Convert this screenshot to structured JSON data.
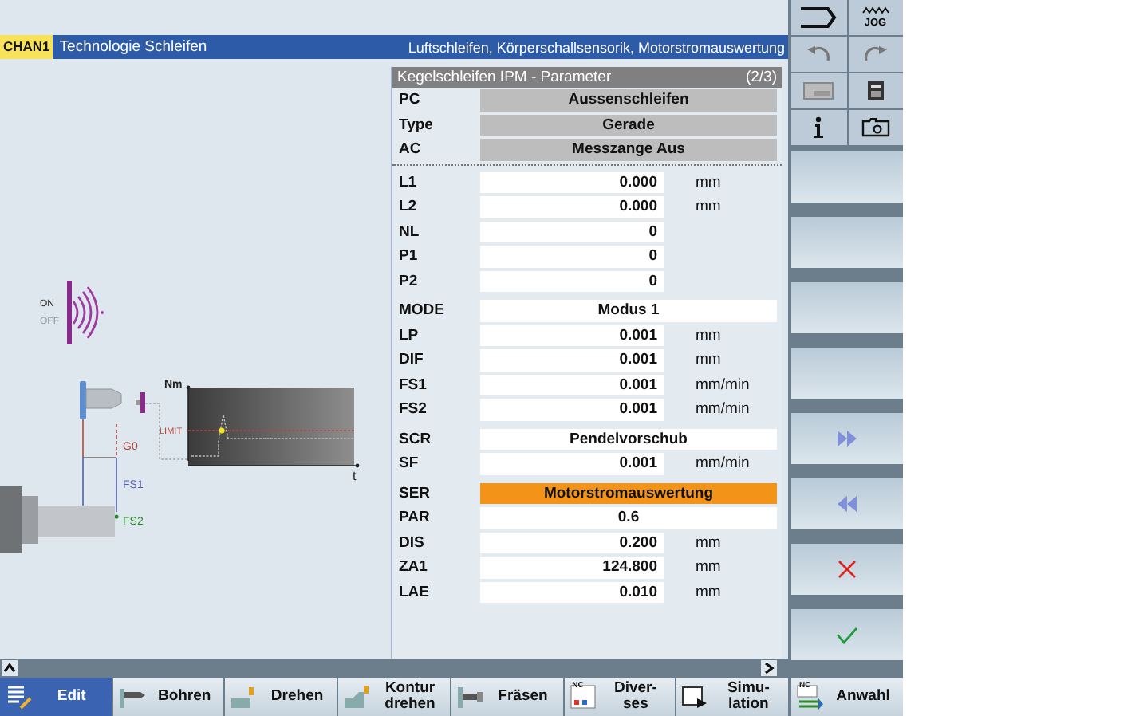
{
  "header": {
    "channel": "CHAN1",
    "title": "Technologie Schleifen",
    "subtitle": "Luftschleifen, Körperschallsensorik, Motorstromauswertung"
  },
  "diagram": {
    "switch": [
      {
        "label": "ON",
        "selected": true
      },
      {
        "label": "OFF",
        "selected": false
      }
    ],
    "y_axis": "Nm",
    "x_axis": "t",
    "limit": "LIMIT",
    "moves": [
      "G0",
      "FS1",
      "FS2"
    ]
  },
  "form": {
    "title": "Kegelschleifen IPM - Parameter",
    "page": "(2/3)",
    "groups": [
      [
        {
          "label": "PC",
          "kind": "toggle",
          "value": "Aussenschleifen",
          "selected": false
        },
        {
          "label": "Type",
          "kind": "toggle",
          "value": "Gerade",
          "selected": false
        },
        {
          "label": "AC",
          "kind": "toggle",
          "value": "Messzange Aus",
          "selected": false
        }
      ],
      [
        {
          "label": "L1",
          "kind": "number",
          "value": "0.000",
          "unit": "mm",
          "selected": false
        },
        {
          "label": "L2",
          "kind": "number",
          "value": "0.000",
          "unit": "mm",
          "selected": false
        },
        {
          "label": "NL",
          "kind": "number",
          "value": "0",
          "selected": false
        },
        {
          "label": "P1",
          "kind": "number",
          "value": "0",
          "selected": false
        },
        {
          "label": "P2",
          "kind": "number",
          "value": "0",
          "selected": false
        }
      ],
      [
        {
          "label": "MODE",
          "kind": "choice",
          "value": "Modus 1",
          "selected": false
        },
        {
          "label": "LP",
          "kind": "number",
          "value": "0.001",
          "unit": "mm",
          "selected": false
        },
        {
          "label": "DIF",
          "kind": "number",
          "value": "0.001",
          "unit": "mm",
          "selected": false
        },
        {
          "label": "FS1",
          "kind": "number",
          "value": "0.001",
          "unit": "mm/min",
          "selected": false
        },
        {
          "label": "FS2",
          "kind": "number",
          "value": "0.001",
          "unit": "mm/min",
          "selected": false
        }
      ],
      [
        {
          "label": "SCR",
          "kind": "choice",
          "value": "Pendelvorschub",
          "selected": false
        },
        {
          "label": "SF",
          "kind": "number",
          "value": "0.001",
          "unit": "mm/min",
          "selected": false
        }
      ],
      [
        {
          "label": "SER",
          "kind": "choice",
          "value": "Motorstromauswertung",
          "selected": true
        },
        {
          "label": "PAR",
          "kind": "choice",
          "value": "0.6",
          "selected": false
        },
        {
          "label": "DIS",
          "kind": "number",
          "value": "0.200",
          "unit": "mm",
          "selected": false
        },
        {
          "label": "ZA1",
          "kind": "number",
          "value": "124.800",
          "unit": "mm",
          "selected": false
        },
        {
          "label": "LAE",
          "kind": "number",
          "value": "0.010",
          "unit": "mm",
          "selected": false
        }
      ]
    ]
  },
  "side_tools": [
    {
      "kind": "return"
    },
    {
      "kind": "jog",
      "label": "JOG"
    },
    {
      "kind": "undo"
    },
    {
      "kind": "redo"
    },
    {
      "kind": "keyboard"
    },
    {
      "kind": "calculator"
    },
    {
      "kind": "info"
    },
    {
      "kind": "camera"
    }
  ],
  "vertical_softkeys": [
    {
      "kind": "empty"
    },
    {
      "kind": "empty"
    },
    {
      "kind": "empty"
    },
    {
      "kind": "empty"
    },
    {
      "kind": "next"
    },
    {
      "kind": "previous"
    },
    {
      "kind": "cancel"
    },
    {
      "kind": "ok"
    }
  ],
  "horizontal_softkeys": [
    {
      "kind": "edit",
      "label": "Edit",
      "selected": true
    },
    {
      "kind": "drill",
      "label": "Bohren",
      "selected": false
    },
    {
      "kind": "turn",
      "label": "Drehen",
      "selected": false
    },
    {
      "kind": "contour",
      "label": "Kontur\ndrehen",
      "selected": false
    },
    {
      "kind": "mill",
      "label": "Fräsen",
      "selected": false
    },
    {
      "kind": "misc",
      "label": "Diver-\nses",
      "icon_text": "NC",
      "selected": false
    },
    {
      "kind": "simulation",
      "label": "Simu-\nlation",
      "selected": false
    }
  ],
  "select_key": {
    "label": "Anwahl",
    "icon_text": "NC"
  }
}
